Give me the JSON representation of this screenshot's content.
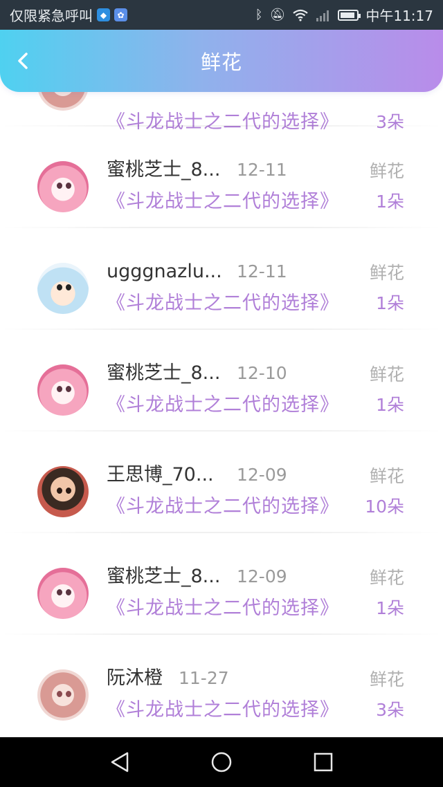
{
  "status_bar": {
    "left_text": "仅限紧急呼叫",
    "time": "中午11:17",
    "battery_level": 0.75,
    "icons": [
      "shield-icon",
      "baidu-icon",
      "bluetooth-icon",
      "mute-icon",
      "wifi-icon",
      "signal-icon",
      "battery-icon"
    ]
  },
  "header": {
    "title": "鲜花",
    "back_icon": "chevron-left-icon",
    "gradient": [
      "#4fd1f0",
      "#b98cea"
    ]
  },
  "list": {
    "partial_row": {
      "book": "《斗龙战士之二代的选择》",
      "count": "3朵"
    },
    "items": [
      {
        "name": "蜜桃芝士_8...",
        "date": "12-11",
        "kind": "鲜花",
        "book": "《斗龙战士之二代的选择》",
        "count": "1朵",
        "avatar": "anime-pink-girl"
      },
      {
        "name": "ugggnazlu...",
        "date": "12-11",
        "kind": "鲜花",
        "book": "《斗龙战士之二代的选择》",
        "count": "1朵",
        "avatar": "cartoon-boy"
      },
      {
        "name": "蜜桃芝士_8...",
        "date": "12-10",
        "kind": "鲜花",
        "book": "《斗龙战士之二代的选择》",
        "count": "1朵",
        "avatar": "anime-pink-girl"
      },
      {
        "name": "王思博_70...",
        "date": "12-09",
        "kind": "鲜花",
        "book": "《斗龙战士之二代的选择》",
        "count": "10朵",
        "avatar": "child-photo"
      },
      {
        "name": "蜜桃芝士_8...",
        "date": "12-09",
        "kind": "鲜花",
        "book": "《斗龙战士之二代的选择》",
        "count": "1朵",
        "avatar": "anime-pink-girl"
      },
      {
        "name": "阮沐橙",
        "date": "11-27",
        "kind": "鲜花",
        "book": "《斗龙战士之二代的选择》",
        "count": "3朵",
        "avatar": "illustrated-girl"
      }
    ]
  },
  "colors": {
    "accent_purple": "#b07fd8",
    "name_text": "#333333",
    "muted_text": "#9a9a9a"
  },
  "nav_bar": {
    "buttons": [
      "back-triangle-icon",
      "home-circle-icon",
      "recents-square-icon"
    ]
  }
}
